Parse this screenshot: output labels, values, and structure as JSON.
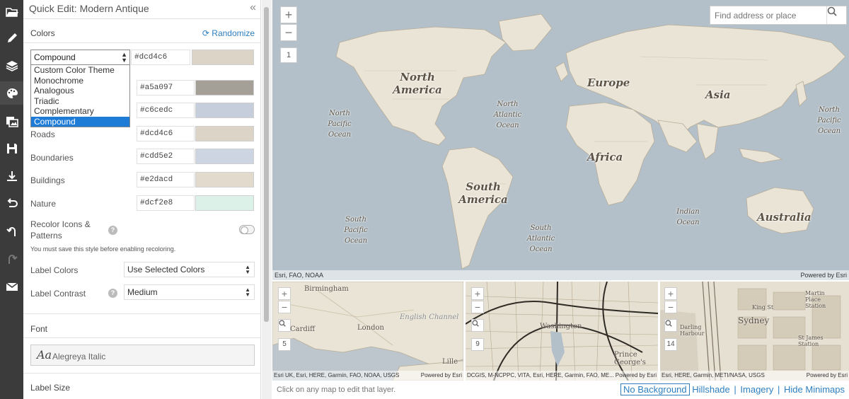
{
  "panel": {
    "title": "Quick Edit: Modern Antique",
    "collapse_icon": "double-chevron-left",
    "colors_heading": "Colors",
    "randomize_label": "Randomize",
    "theme_selected": "Compound",
    "theme_hex": "#dcd4c6",
    "theme_options": [
      "Custom Color Theme",
      "Monochrome",
      "Analogous",
      "Triadic",
      "Complementary",
      "Compound"
    ],
    "hidden_rows": [
      {
        "hex": "#a5a097"
      },
      {
        "hex": "#c6cedc"
      }
    ],
    "color_rows": [
      {
        "label": "Roads",
        "hex": "#dcd4c6"
      },
      {
        "label": "Boundaries",
        "hex": "#cdd5e2"
      },
      {
        "label": "Buildings",
        "hex": "#e2dacd"
      },
      {
        "label": "Nature",
        "hex": "#dcf2e8"
      }
    ],
    "recolor_label_1": "Recolor Icons &",
    "recolor_label_2": "Patterns",
    "recolor_note": "You must save this style before enabling recoloring.",
    "label_colors_label": "Label Colors",
    "label_colors_value": "Use Selected Colors",
    "label_contrast_label": "Label Contrast",
    "label_contrast_value": "Medium",
    "font_heading": "Font",
    "font_sample": "Aa",
    "font_name": "Alegreya Italic",
    "label_size_heading": "Label Size"
  },
  "toolbar": {
    "icons": [
      "folder-open-icon",
      "pencil-icon",
      "layers-icon",
      "palette-icon",
      "image-layers-icon",
      "save-icon",
      "download-icon",
      "undo-icon",
      "undo-arrow-icon",
      "redo-icon",
      "mail-icon"
    ]
  },
  "main_map": {
    "zoom_in": "+",
    "zoom_out": "−",
    "zoom_level": "1",
    "search_placeholder": "Find address or place",
    "attribution_left": "Esri, FAO, NOAA",
    "attribution_right": "Powered by Esri",
    "labels": {
      "north_america": "North America",
      "south_america": "South America",
      "europe": "Europe",
      "asia": "Asia",
      "africa": "Africa",
      "australia": "Australia",
      "north_pacific_left": "North Pacific Ocean",
      "north_pacific_right": "North Pacific Ocean",
      "north_atlantic": "North Atlantic Ocean",
      "south_pacific": "South Pacific Ocean",
      "south_atlantic": "South Atlantic Ocean",
      "indian": "Indian Ocean"
    }
  },
  "minimaps": [
    {
      "zoom_level": "5",
      "labels": [
        "Birmingham",
        "London",
        "English Channel",
        "Lille",
        "Cardiff"
      ],
      "attribution_left": "Esri UK, Esri, HERE, Garmin, FAO, NOAA, USGS",
      "attribution_right": "Powered by Esri"
    },
    {
      "zoom_level": "9",
      "labels": [
        "Washington",
        "Prince George's"
      ],
      "attribution_left": "DCGIS, M-NCPPC, VITA, Esri, HERE, Garmin, FAO, ME...",
      "attribution_right": "Powered by Esri"
    },
    {
      "zoom_level": "14",
      "labels": [
        "Sydney",
        "King St",
        "Martin Place Station",
        "St James Station",
        "Darling Harbour"
      ],
      "attribution_left": "Esri, HERE, Garmin, METI/NASA, USGS",
      "attribution_right": "Powered by Esri"
    }
  ],
  "bottom": {
    "hint": "Click on any map to edit that layer.",
    "links": [
      "No Background",
      "Hillshade",
      "Imagery",
      "Hide Minimaps"
    ]
  },
  "colors": {
    "toolbar_bg": "#3b3b3b",
    "accent": "#2e7fc0",
    "dropdown_selected": "#1e7bd6",
    "ocean": "#b3c0c9",
    "land": "#e9e4d6",
    "swatch_a5a097": "#a5a097",
    "swatch_c6cedc": "#c6cedc"
  }
}
